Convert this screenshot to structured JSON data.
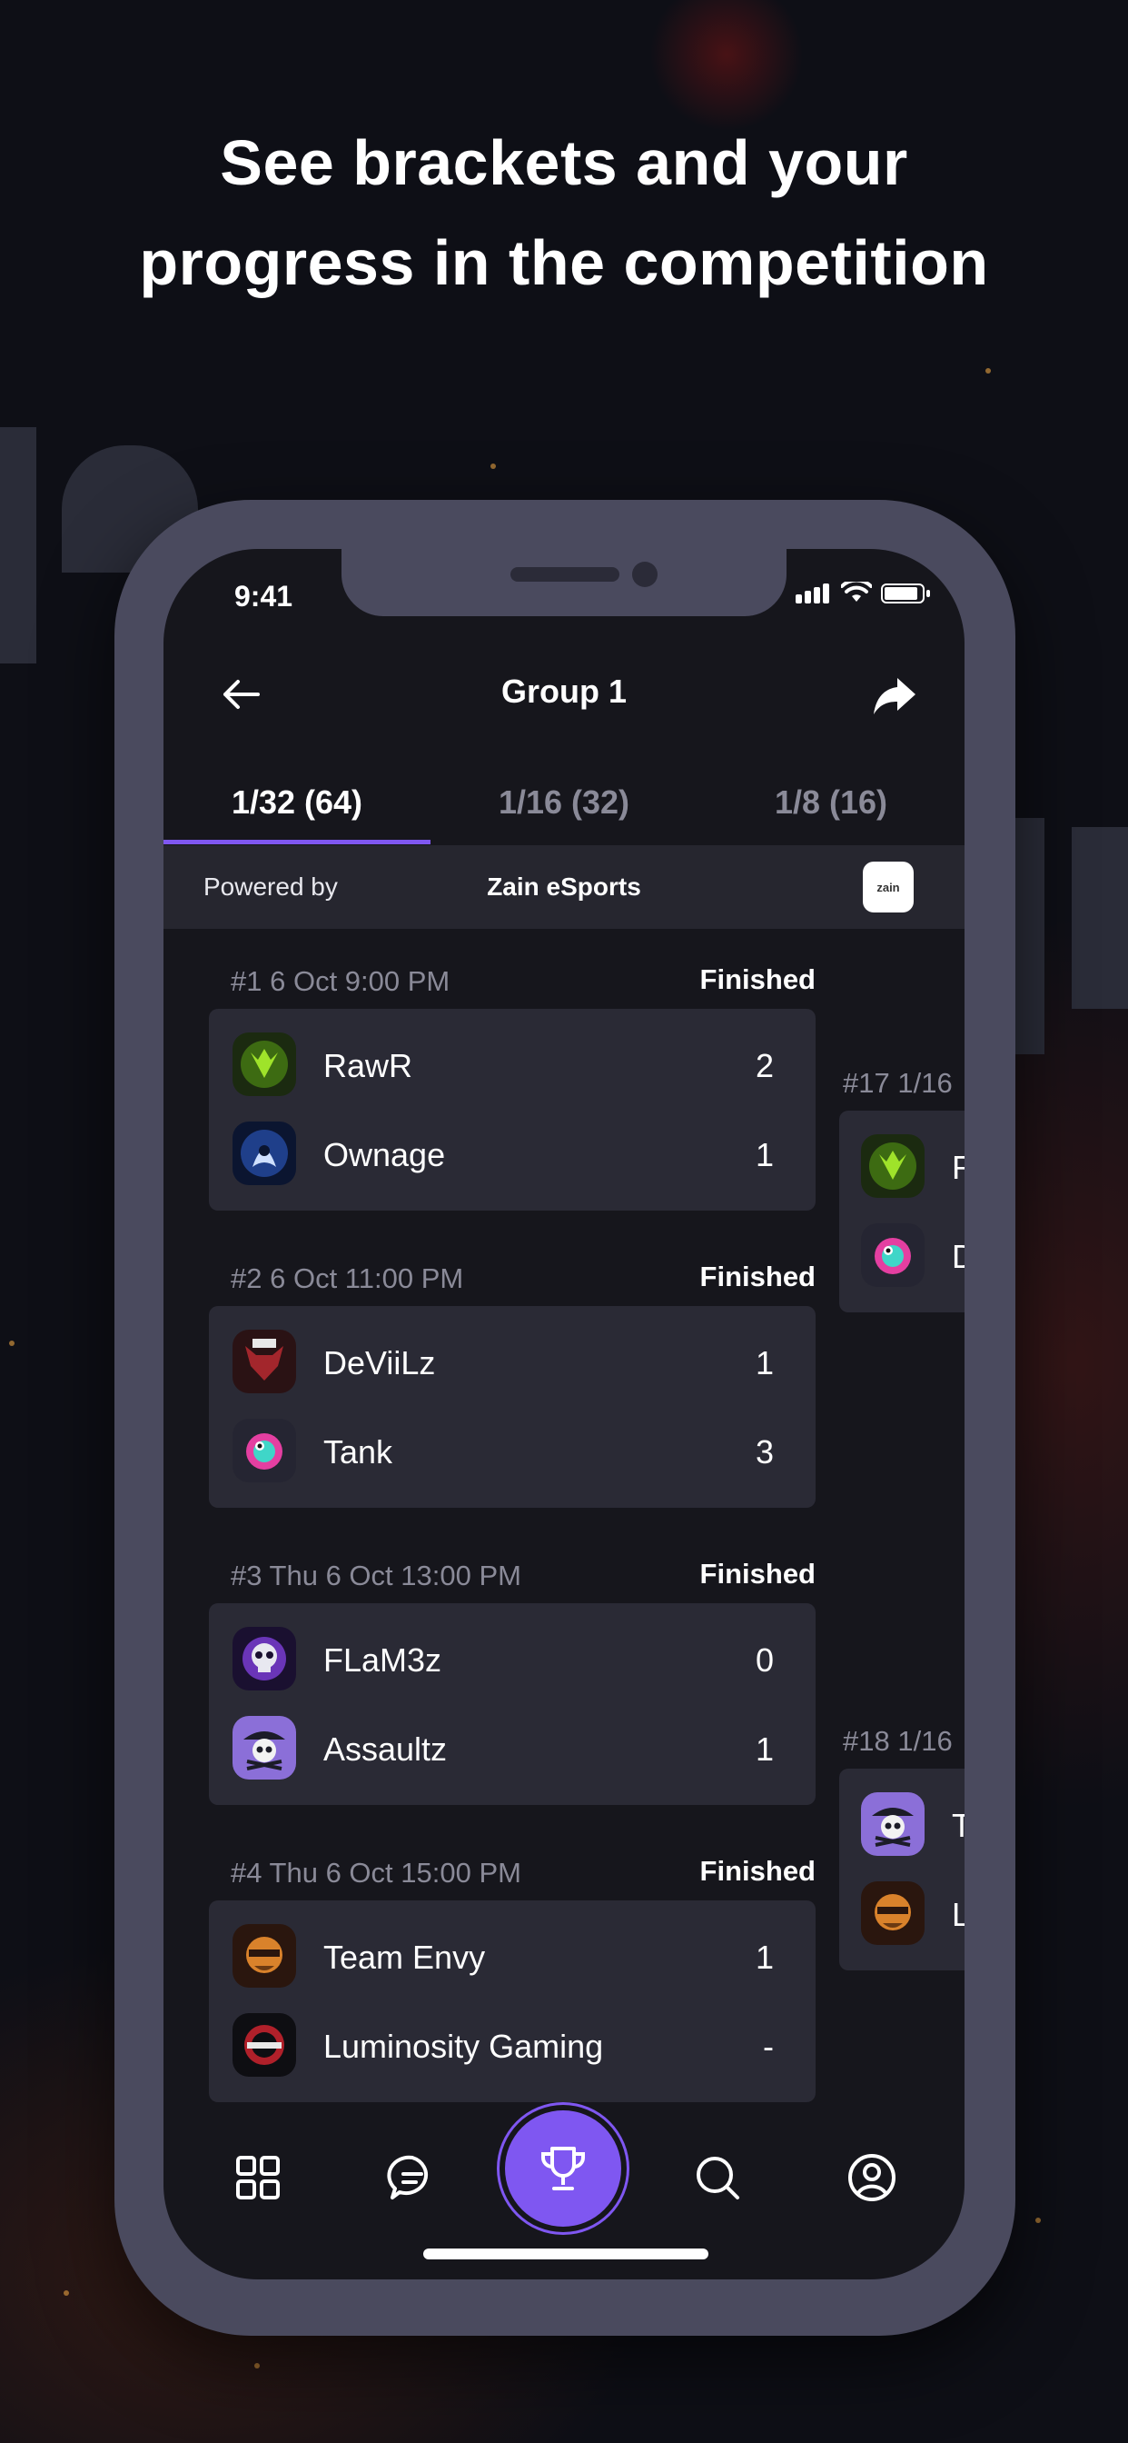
{
  "headline": {
    "line1": "See brackets and your",
    "line2": "progress in the competition"
  },
  "status_bar": {
    "time": "9:41"
  },
  "header": {
    "title": "Group 1",
    "back_icon": "arrow-left-icon",
    "share_icon": "share-icon"
  },
  "tabs": [
    {
      "label": "1/32 (64)",
      "active": true
    },
    {
      "label": "1/16 (32)",
      "active": false
    },
    {
      "label": "1/8 (16)",
      "active": false
    }
  ],
  "powered": {
    "label": "Powered by",
    "name": "Zain eSports",
    "logo_text": "zain"
  },
  "matches": [
    {
      "number": "#1",
      "date": "6 Oct 9:00 PM",
      "status": "Finished",
      "teams": [
        {
          "name": "RawR",
          "score": "2",
          "logo": "green-gargoyle"
        },
        {
          "name": "Ownage",
          "score": "1",
          "logo": "blue-reaper"
        }
      ]
    },
    {
      "number": "#2",
      "date": "6 Oct 11:00 PM",
      "status": "Finished",
      "teams": [
        {
          "name": "DeViiLz",
          "score": "1",
          "logo": "red-bull"
        },
        {
          "name": "Tank",
          "score": "3",
          "logo": "chameleon"
        }
      ]
    },
    {
      "number": "#3",
      "date": "Thu 6 Oct 13:00 PM",
      "status": "Finished",
      "teams": [
        {
          "name": "FLaM3z",
          "score": "0",
          "logo": "purple-skull"
        },
        {
          "name": "Assaultz",
          "score": "1",
          "logo": "pirate"
        }
      ]
    },
    {
      "number": "#4",
      "date": "Thu 6 Oct 15:00 PM",
      "status": "Finished",
      "teams": [
        {
          "name": "Team Envy",
          "score": "1",
          "logo": "orange-bandit"
        },
        {
          "name": "Luminosity Gaming",
          "score": "-",
          "logo": "red-crest"
        }
      ]
    }
  ],
  "next_round": [
    {
      "number": "#17",
      "date": "1/16",
      "teams": [
        {
          "initial": "R",
          "logo": "green-gargoyle"
        },
        {
          "initial": "D",
          "logo": "chameleon"
        }
      ]
    },
    {
      "number": "#18",
      "date": "1/16",
      "teams": [
        {
          "initial": "T",
          "logo": "pirate"
        },
        {
          "initial": "L",
          "logo": "orange-bandit"
        }
      ]
    }
  ],
  "bottom_nav": [
    {
      "icon": "grid-icon"
    },
    {
      "icon": "chat-icon"
    },
    {
      "icon": "trophy-icon",
      "active": true
    },
    {
      "icon": "search-icon"
    },
    {
      "icon": "profile-icon"
    }
  ],
  "colors": {
    "accent": "#7f57f1",
    "card": "#2a2a35",
    "screen": "#16161c",
    "frame": "#4a4a5e"
  }
}
